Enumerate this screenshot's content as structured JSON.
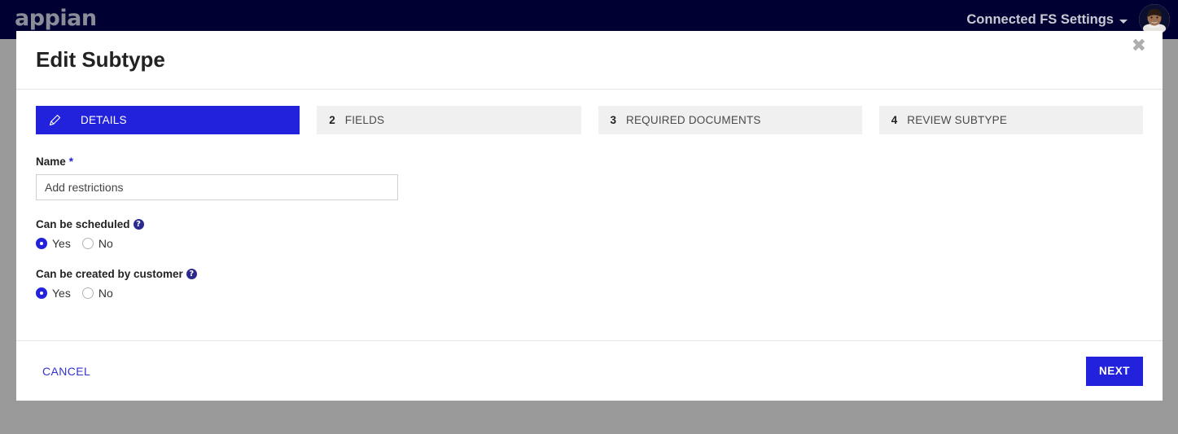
{
  "app_bar": {
    "brand": "appian",
    "nav_menu_label": "Connected FS Settings",
    "caret_icon": "chevron-down-icon",
    "avatar_icon": "user-avatar"
  },
  "modal": {
    "title": "Edit Subtype",
    "close_label": "✖",
    "tabs": [
      {
        "num": "",
        "label": "DETAILS",
        "icon": "pencil-edit-icon",
        "active": true
      },
      {
        "num": "2",
        "label": "FIELDS",
        "icon": "",
        "active": false
      },
      {
        "num": "3",
        "label": "REQUIRED DOCUMENTS",
        "icon": "",
        "active": false
      },
      {
        "num": "4",
        "label": "REVIEW SUBTYPE",
        "icon": "",
        "active": false
      }
    ],
    "form": {
      "name_label": "Name",
      "name_required_mark": "*",
      "name_value": "Add restrictions",
      "name_placeholder": "Add restrictions",
      "scheduled": {
        "label": "Can be scheduled",
        "help_icon": "help-question-icon",
        "help_glyph": "?",
        "options": [
          {
            "label": "Yes",
            "selected": true
          },
          {
            "label": "No",
            "selected": false
          }
        ]
      },
      "created_by_customer": {
        "label": "Can be created by customer",
        "help_icon": "help-question-icon",
        "help_glyph": "?",
        "options": [
          {
            "label": "Yes",
            "selected": true
          },
          {
            "label": "No",
            "selected": false
          }
        ]
      }
    },
    "footer": {
      "cancel_label": "CANCEL",
      "next_label": "NEXT"
    }
  },
  "colors": {
    "header_navy": "#000033",
    "accent_blue": "#2222dd",
    "link_blue": "#3333cc",
    "backdrop_grey": "#9a9a9a",
    "tab_inactive": "#f0f0f0"
  }
}
